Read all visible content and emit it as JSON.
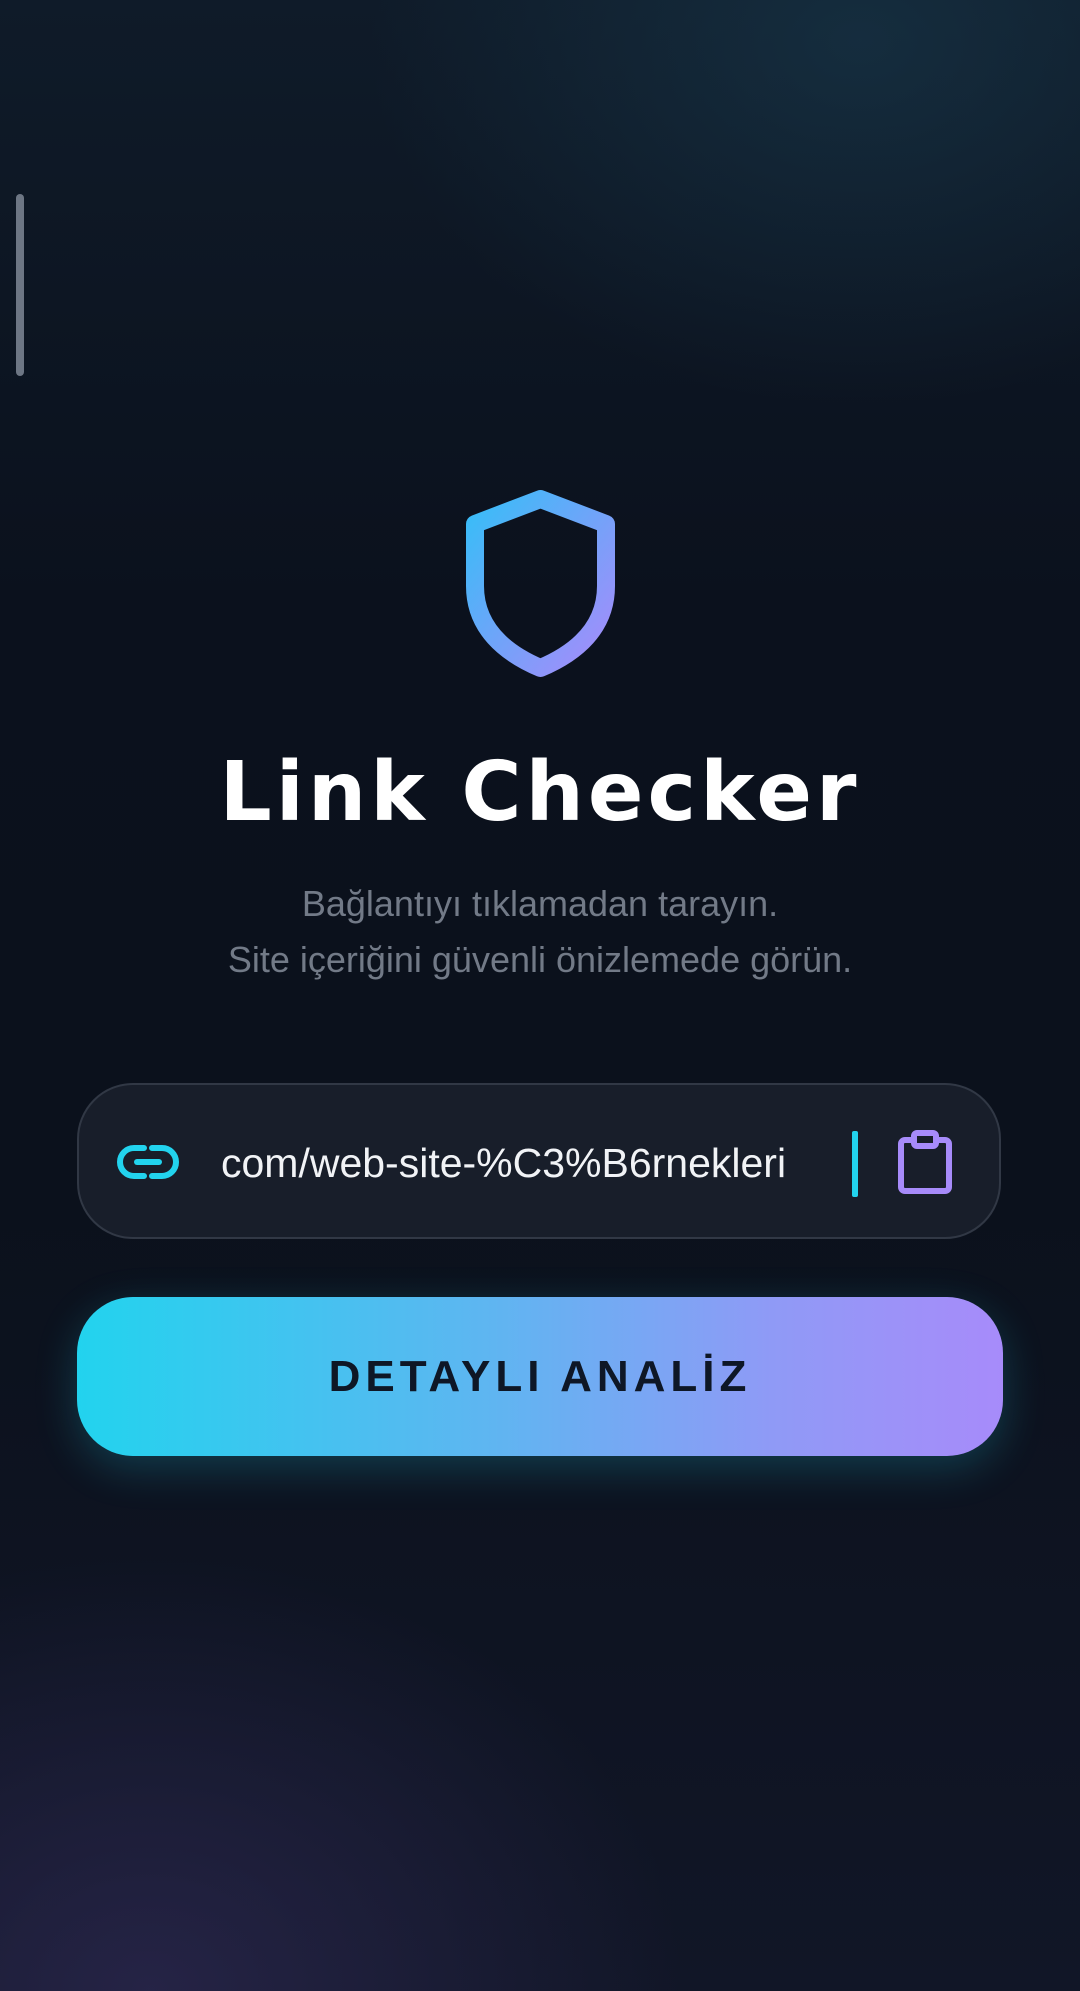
{
  "app": {
    "title": "Link Checker",
    "subtitle_line1": "Bağlantıyı tıklamadan tarayın.",
    "subtitle_line2": "Site içeriğini güvenli önizlemede görün."
  },
  "url_input": {
    "value": "com/web-site-%C3%B6rnekleri"
  },
  "analyze_button": {
    "label": "DETAYLI ANALİZ"
  },
  "icons": {
    "logo": "shield-icon",
    "input_leading": "link-icon",
    "input_trailing": "clipboard-icon"
  },
  "colors": {
    "accent_cyan": "#22d3ee",
    "accent_purple": "#a78bfa",
    "background": "#0b111d",
    "field_background": "#181e2a",
    "subtitle_text": "#727a87"
  }
}
